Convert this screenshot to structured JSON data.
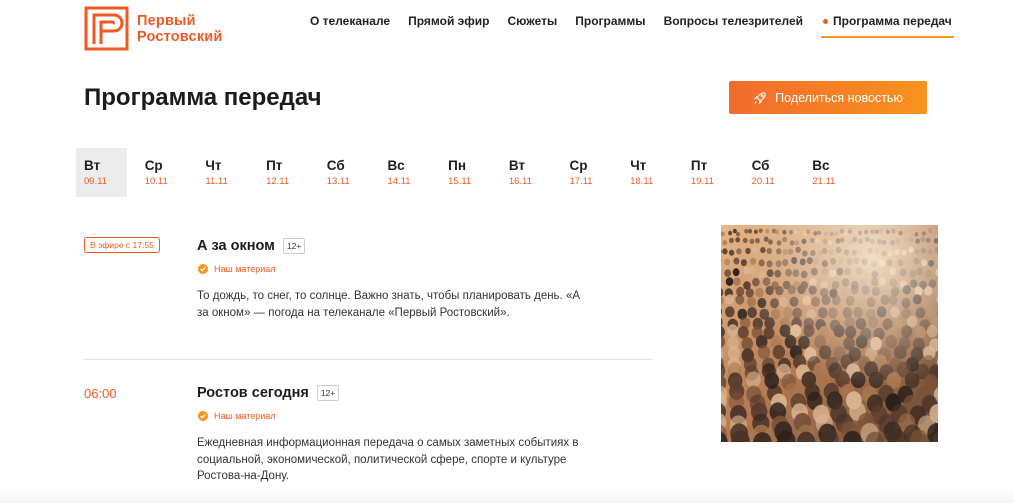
{
  "brand": {
    "line1": "Первый",
    "line2": "Ростовский",
    "color": "#ef5a24"
  },
  "nav": [
    {
      "label": "О телеканале",
      "active": false
    },
    {
      "label": "Прямой эфир",
      "active": false
    },
    {
      "label": "Сюжеты",
      "active": false
    },
    {
      "label": "Программы",
      "active": false
    },
    {
      "label": "Вопросы телезрителей",
      "active": false
    },
    {
      "label": "Программа передач",
      "active": true
    }
  ],
  "page": {
    "title": "Программа передач",
    "share_label": "Поделиться новостью",
    "share_icon": "rocket-icon"
  },
  "days": [
    {
      "name": "Вт",
      "date": "09.11",
      "active": true
    },
    {
      "name": "Ср",
      "date": "10.11"
    },
    {
      "name": "Чт",
      "date": "11.11"
    },
    {
      "name": "Пт",
      "date": "12.11"
    },
    {
      "name": "Сб",
      "date": "13.11"
    },
    {
      "name": "Вс",
      "date": "14.11"
    },
    {
      "name": "Пн",
      "date": "15.11"
    },
    {
      "name": "Вт",
      "date": "16.11"
    },
    {
      "name": "Ср",
      "date": "17.11"
    },
    {
      "name": "Чт",
      "date": "18.11"
    },
    {
      "name": "Пт",
      "date": "19.11"
    },
    {
      "name": "Сб",
      "date": "20.11"
    },
    {
      "name": "Вс",
      "date": "21.11"
    }
  ],
  "programs": [
    {
      "status": "В эфире с 17:55",
      "title": "А за окном",
      "age": "12+",
      "badge": "Наш материал",
      "description": "То дождь, то снег, то солнце. Важно знать, чтобы планировать день. «А за окном» — погода на телеканале «Первый Ростовский»."
    },
    {
      "time": "06:00",
      "title": "Ростов сегодня",
      "age": "12+",
      "badge": "Наш материал",
      "description": "Ежедневная информационная передача о самых заметных событиях  в социальной, экономической, политической сфере, спорте и культуре  Ростова-на-Дону."
    }
  ],
  "colors": {
    "accent": "#ef5a24",
    "accent_gradient_end": "#f7931e",
    "active_day_bg": "#ececec"
  }
}
